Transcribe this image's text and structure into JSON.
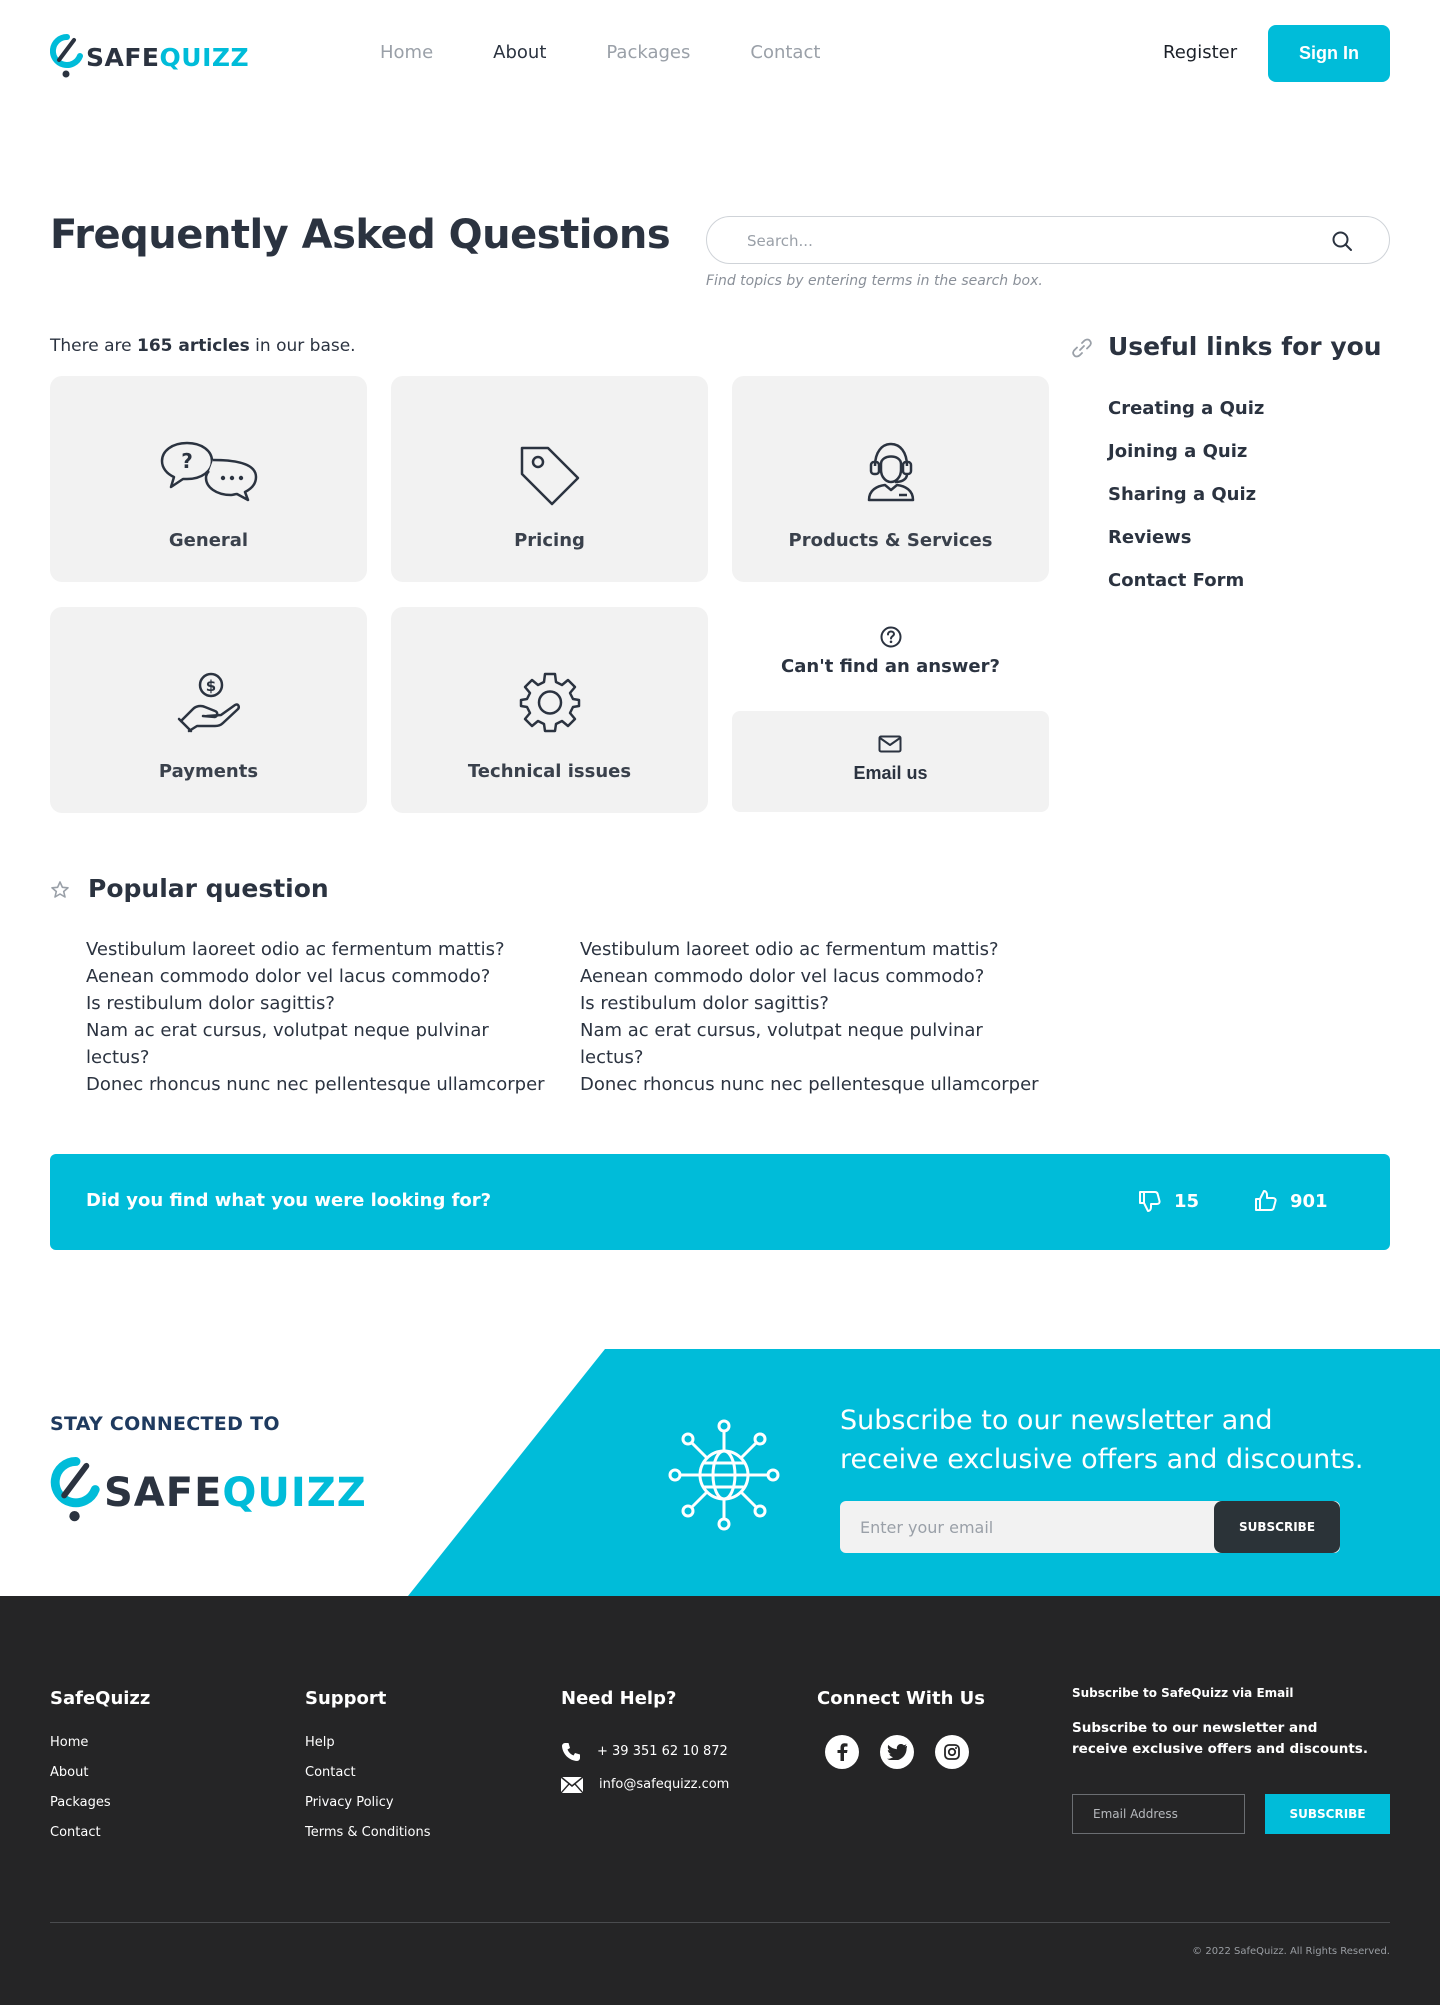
{
  "brand": {
    "safe": "SAFE",
    "quizz": "QUIZZ",
    "accent_color": "#00bcd9",
    "dark_color": "#2b3340"
  },
  "nav": {
    "items": [
      {
        "label": "Home",
        "active": false
      },
      {
        "label": "About",
        "active": true
      },
      {
        "label": "Packages",
        "active": false
      },
      {
        "label": "Contact",
        "active": false
      }
    ],
    "register": "Register",
    "signin": "Sign In"
  },
  "faq": {
    "title": "Frequently Asked Questions",
    "search_placeholder": "Search...",
    "search_hint": "Find topics by entering terms in the search box.",
    "articles_prefix": "There are ",
    "articles_count": "165 articles",
    "articles_suffix": " in our base."
  },
  "categories": [
    {
      "label": "General",
      "icon": "chat-bubbles-icon"
    },
    {
      "label": "Pricing",
      "icon": "price-tag-icon"
    },
    {
      "label": "Products & Services",
      "icon": "support-agent-icon"
    },
    {
      "label": "Payments",
      "icon": "hand-coin-icon"
    },
    {
      "label": "Technical issues",
      "icon": "gear-icon"
    }
  ],
  "cant_find": {
    "text": "Can't find an answer?",
    "email_label": "Email us"
  },
  "useful_links": {
    "title": "Useful links for you",
    "items": [
      "Creating a Quiz",
      "Joining a Quiz",
      "Sharing a Quiz",
      "Reviews",
      "Contact Form"
    ]
  },
  "popular": {
    "title": "Popular question",
    "left": [
      "Vestibulum laoreet odio ac fermentum mattis?",
      "Aenean commodo dolor vel lacus commodo?",
      "Is restibulum dolor sagittis?",
      "Nam ac erat cursus, volutpat neque pulvinar lectus?",
      "Donec rhoncus nunc nec pellentesque ullamcorper"
    ],
    "right": [
      "Vestibulum laoreet odio ac fermentum mattis?",
      "Aenean commodo dolor vel lacus commodo?",
      "Is restibulum dolor sagittis?",
      "Nam ac erat cursus, volutpat neque pulvinar lectus?",
      "Donec rhoncus nunc nec pellentesque ullamcorper"
    ]
  },
  "feedback": {
    "question": "Did you find what you were looking for?",
    "dislikes": "15",
    "likes": "901"
  },
  "stay": {
    "label": "STAY CONNECTED TO",
    "newsletter_text": "Subscribe to our newsletter and receive exclusive offers and discounts.",
    "email_placeholder": "Enter your email",
    "subscribe": "SUBSCRIBE"
  },
  "footer": {
    "col1": {
      "title": "SafeQuizz",
      "items": [
        "Home",
        "About",
        "Packages",
        "Contact"
      ]
    },
    "col2": {
      "title": "Support",
      "items": [
        "Help",
        "Contact",
        "Privacy Policy",
        "Terms & Conditions"
      ]
    },
    "col3": {
      "title": "Need Help?",
      "phone": "+ 39 351 62 10 872",
      "email": "info@safequizz.com"
    },
    "col4": {
      "title": "Connect With Us",
      "socials": [
        "facebook-icon",
        "twitter-icon",
        "instagram-icon"
      ]
    },
    "subscribe": {
      "title": "Subscribe to SafeQuizz via Email",
      "text": "Subscribe to our newsletter and receive exclusive offers and discounts.",
      "placeholder": "Email Address",
      "button": "SUBSCRIBE"
    },
    "copyright": "© 2022 SafeQuizz. All Rights Reserved."
  }
}
